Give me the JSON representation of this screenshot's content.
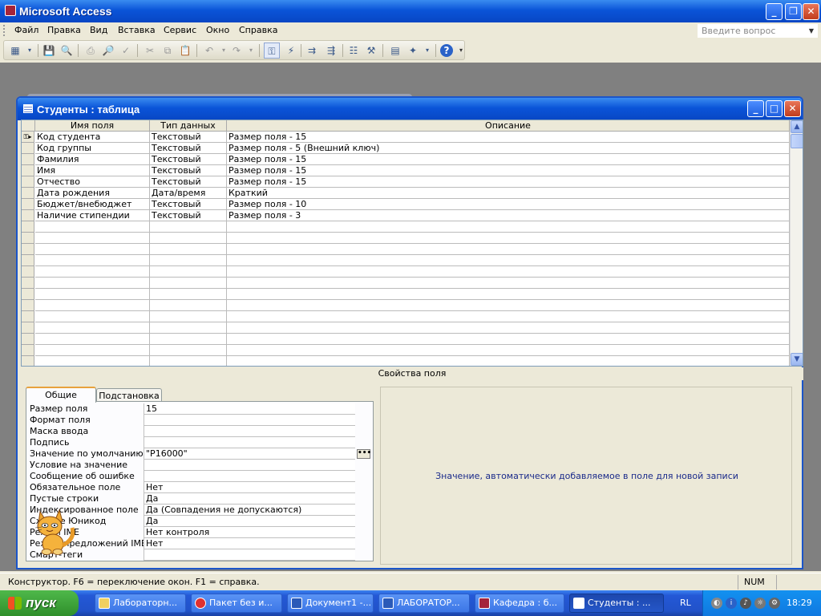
{
  "app": {
    "title": "Microsoft Access"
  },
  "menu": [
    "Файл",
    "Правка",
    "Вид",
    "Вставка",
    "Сервис",
    "Окно",
    "Справка"
  ],
  "search": {
    "placeholder": "Введите вопрос"
  },
  "window": {
    "title": "Студенты : таблица"
  },
  "grid": {
    "columns": [
      "Имя поля",
      "Тип данных",
      "Описание"
    ],
    "rows": [
      {
        "name": "Код студента",
        "type": "Текстовый",
        "desc": "Размер поля - 15"
      },
      {
        "name": "Код группы",
        "type": "Текстовый",
        "desc": " Размер поля - 5 (Внешний ключ)"
      },
      {
        "name": "Фамилия",
        "type": "Текстовый",
        "desc": "Размер поля - 15"
      },
      {
        "name": "Имя",
        "type": "Текстовый",
        "desc": "Размер поля - 15"
      },
      {
        "name": "Отчество",
        "type": "Текстовый",
        "desc": "Размер поля - 15"
      },
      {
        "name": "Дата рождения",
        "type": "Дата/время",
        "desc": "Краткий"
      },
      {
        "name": "Бюджет/внебюджет",
        "type": "Текстовый",
        "desc": "Размер поля - 10"
      },
      {
        "name": "Наличие стипендии",
        "type": "Текстовый",
        "desc": "Размер поля - 3"
      }
    ]
  },
  "props": {
    "title": "Свойства поля",
    "tabs": [
      "Общие",
      "Подстановка"
    ],
    "items": [
      {
        "label": "Размер поля",
        "value": "15"
      },
      {
        "label": "Формат поля",
        "value": ""
      },
      {
        "label": "Маска ввода",
        "value": ""
      },
      {
        "label": "Подпись",
        "value": ""
      },
      {
        "label": "Значение по умолчанию",
        "value": "\"Р16000\""
      },
      {
        "label": "Условие на значение",
        "value": ""
      },
      {
        "label": "Сообщение об ошибке",
        "value": ""
      },
      {
        "label": "Обязательное поле",
        "value": "Нет"
      },
      {
        "label": "Пустые строки",
        "value": "Да"
      },
      {
        "label": "Индексированное поле",
        "value": "Да (Совпадения не допускаются)"
      },
      {
        "label": "Сжатие Юникод",
        "value": "Да"
      },
      {
        "label": "Режим IME",
        "value": "Нет контроля"
      },
      {
        "label": "Режим предложений IME",
        "value": "Нет"
      },
      {
        "label": "Смарт-теги",
        "value": ""
      }
    ],
    "help": "Значение, автоматически добавляемое в поле для новой записи"
  },
  "status": {
    "text": "Конструктор.  F6 = переключение окон.  F1 = справка.",
    "num": "NUM"
  },
  "taskbar": {
    "start": "пуск",
    "tasks": [
      "Лабораторн...",
      "Пакет без и...",
      "Документ1 -...",
      "ЛАБОРАТОР...",
      "Кафедра : б...",
      "Студенты : ..."
    ],
    "lang": "RL",
    "time": "18:29"
  }
}
